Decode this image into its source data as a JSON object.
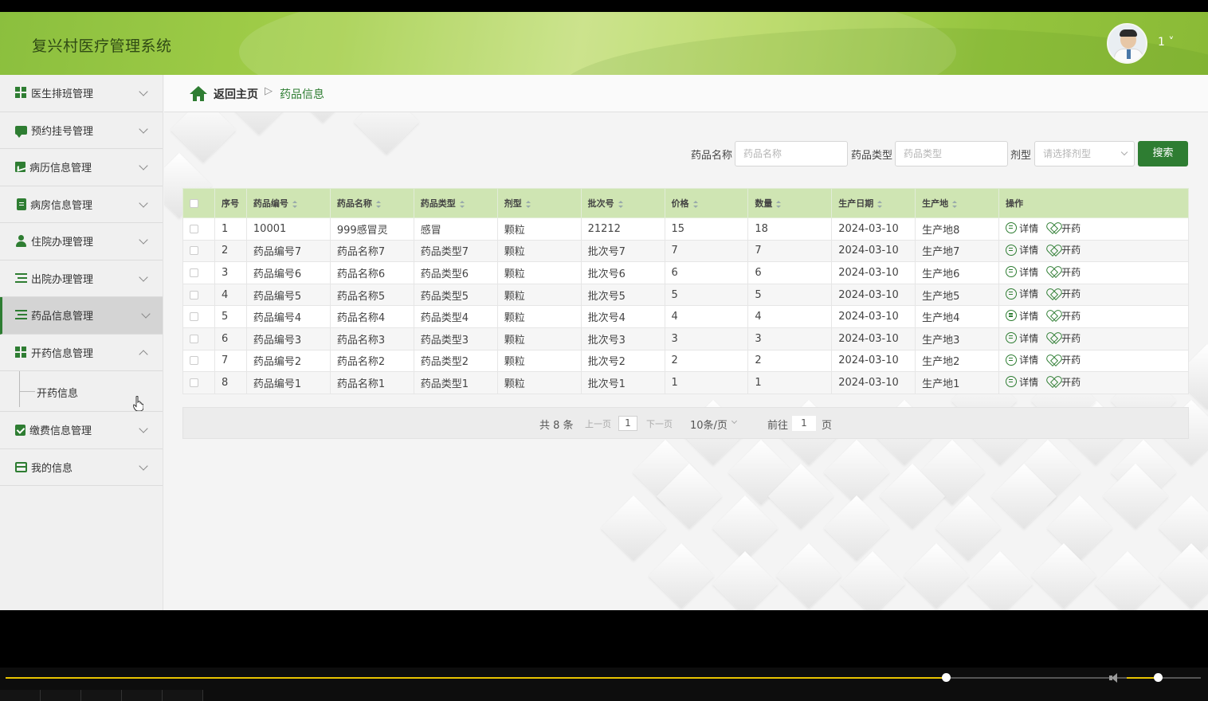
{
  "app": {
    "title": "复兴村医疗管理系统",
    "user": "1 ˅"
  },
  "sidebar": {
    "items": [
      {
        "label": "医生排班管理",
        "icon": "grid-icon",
        "expanded": false
      },
      {
        "label": "预约挂号管理",
        "icon": "chat-icon",
        "expanded": false
      },
      {
        "label": "病历信息管理",
        "icon": "chart-icon",
        "expanded": false
      },
      {
        "label": "病房信息管理",
        "icon": "clipboard-icon",
        "expanded": false
      },
      {
        "label": "住院办理管理",
        "icon": "user-icon",
        "expanded": false
      },
      {
        "label": "出院办理管理",
        "icon": "list-icon",
        "expanded": false
      },
      {
        "label": "药品信息管理",
        "icon": "list-icon",
        "expanded": false,
        "active": true
      },
      {
        "label": "开药信息管理",
        "icon": "grid-icon",
        "expanded": true
      },
      {
        "label": "缴费信息管理",
        "icon": "check-icon",
        "expanded": false
      },
      {
        "label": "我的信息",
        "icon": "card-icon",
        "expanded": false
      }
    ],
    "sub_item": "开药信息"
  },
  "breadcrumb": {
    "home": "返回主页",
    "separator": "▷",
    "current": "药品信息"
  },
  "search": {
    "name_label": "药品名称",
    "name_placeholder": "药品名称",
    "type_label": "药品类型",
    "type_placeholder": "药品类型",
    "form_label": "剂型",
    "form_placeholder": "请选择剂型",
    "button": "搜索"
  },
  "table": {
    "headers": [
      "序号",
      "药品编号",
      "药品名称",
      "药品类型",
      "剂型",
      "批次号",
      "价格",
      "数量",
      "生产日期",
      "生产地",
      "操作"
    ],
    "rows": [
      [
        "1",
        "10001",
        "999感冒灵",
        "感冒",
        "颗粒",
        "21212",
        "15",
        "18",
        "2024-03-10",
        "生产地8"
      ],
      [
        "2",
        "药品编号7",
        "药品名称7",
        "药品类型7",
        "颗粒",
        "批次号7",
        "7",
        "7",
        "2024-03-10",
        "生产地7"
      ],
      [
        "3",
        "药品编号6",
        "药品名称6",
        "药品类型6",
        "颗粒",
        "批次号6",
        "6",
        "6",
        "2024-03-10",
        "生产地6"
      ],
      [
        "4",
        "药品编号5",
        "药品名称5",
        "药品类型5",
        "颗粒",
        "批次号5",
        "5",
        "5",
        "2024-03-10",
        "生产地5"
      ],
      [
        "5",
        "药品编号4",
        "药品名称4",
        "药品类型4",
        "颗粒",
        "批次号4",
        "4",
        "4",
        "2024-03-10",
        "生产地4"
      ],
      [
        "6",
        "药品编号3",
        "药品名称3",
        "药品类型3",
        "颗粒",
        "批次号3",
        "3",
        "3",
        "2024-03-10",
        "生产地3"
      ],
      [
        "7",
        "药品编号2",
        "药品名称2",
        "药品类型2",
        "颗粒",
        "批次号2",
        "2",
        "2",
        "2024-03-10",
        "生产地2"
      ],
      [
        "8",
        "药品编号1",
        "药品名称1",
        "药品类型1",
        "颗粒",
        "批次号1",
        "1",
        "1",
        "2024-03-10",
        "生产地1"
      ]
    ],
    "action_detail": "详情",
    "action_prescribe": "开药"
  },
  "pagination": {
    "total": "共 8 条",
    "prev": "上一页",
    "page": "1",
    "next": "下一页",
    "page_size": "10条/页",
    "goto_label": "前往",
    "goto_value": "1",
    "goto_suffix": "页"
  },
  "player": {
    "progress": 0.787,
    "volume": 0.44
  },
  "colors": {
    "accent": "#2e7d32",
    "header": "#9ccb45",
    "table_header": "#cfe5b3"
  }
}
